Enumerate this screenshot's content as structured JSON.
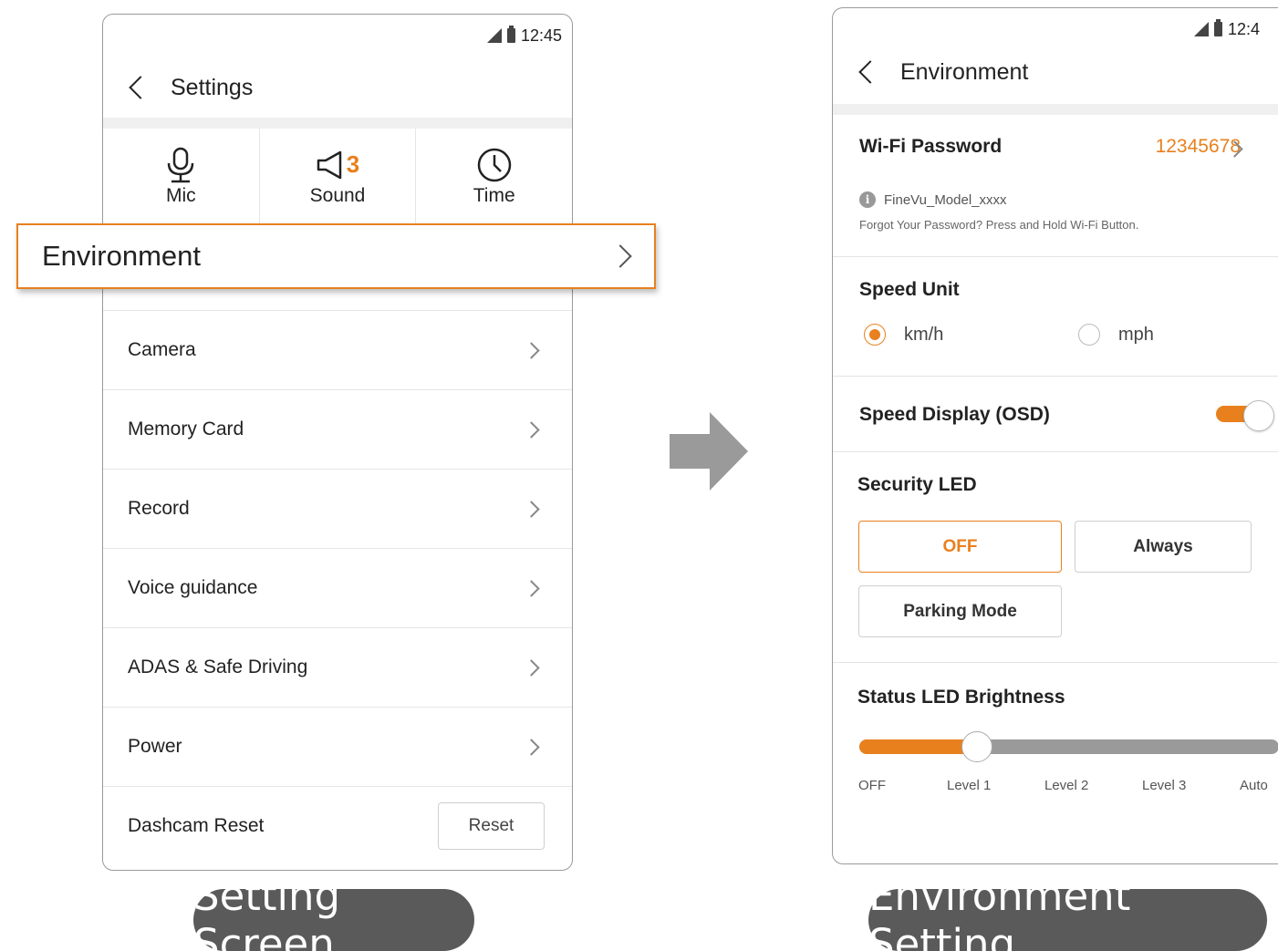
{
  "left_screen": {
    "status": {
      "time": "12:45"
    },
    "header": {
      "title": "Settings"
    },
    "quick": [
      {
        "label": "Mic",
        "icon": "mic-icon"
      },
      {
        "label": "Sound",
        "icon": "speaker-icon",
        "value": "3"
      },
      {
        "label": "Time",
        "icon": "clock-icon"
      }
    ],
    "highlight": {
      "label": "Environment"
    },
    "menu": [
      {
        "label": "Camera"
      },
      {
        "label": "Memory Card"
      },
      {
        "label": "Record"
      },
      {
        "label": "Voice guidance"
      },
      {
        "label": "ADAS & Safe Driving"
      },
      {
        "label": "Power"
      }
    ],
    "reset_row": {
      "label": "Dashcam Reset",
      "button": "Reset"
    }
  },
  "right_screen": {
    "status": {
      "time": "12:4"
    },
    "header": {
      "title": "Environment"
    },
    "wifi": {
      "title": "Wi-Fi Password",
      "value": "12345678",
      "model": "FineVu_Model_xxxx",
      "hint": "Forgot Your Password? Press and Hold Wi-Fi Button."
    },
    "speed_unit": {
      "title": "Speed Unit",
      "options": [
        "km/h",
        "mph"
      ],
      "selected": "km/h"
    },
    "speed_display": {
      "title": "Speed Display (OSD)",
      "enabled": true
    },
    "security_led": {
      "title": "Security LED",
      "options": [
        "OFF",
        "Always",
        "Parking Mode"
      ],
      "selected": "OFF"
    },
    "status_led": {
      "title": "Status LED Brightness",
      "levels": [
        "OFF",
        "Level 1",
        "Level 2",
        "Level 3",
        "Auto"
      ],
      "selected": "Level 1",
      "selected_index": 1
    }
  },
  "captions": {
    "left": "Setting Screen",
    "right": "Environment Setting"
  },
  "colors": {
    "accent": "#e8801e",
    "caption_bg": "#5a5a5a",
    "arrow": "#9a9a9a"
  }
}
